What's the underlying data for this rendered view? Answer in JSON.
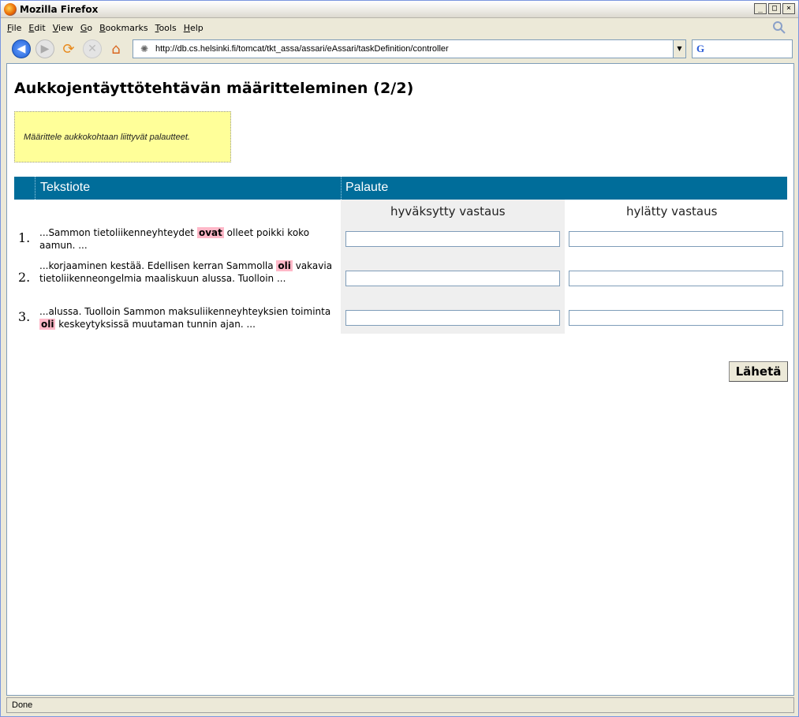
{
  "window": {
    "title": "Mozilla Firefox",
    "controls": {
      "minimize": "_",
      "maximize": "□",
      "close": "×"
    }
  },
  "menu": {
    "items": [
      {
        "underline": "F",
        "rest": "ile"
      },
      {
        "underline": "E",
        "rest": "dit"
      },
      {
        "underline": "V",
        "rest": "iew"
      },
      {
        "underline": "G",
        "rest": "o"
      },
      {
        "underline": "B",
        "rest": "ookmarks"
      },
      {
        "underline": "T",
        "rest": "ools"
      },
      {
        "underline": "H",
        "rest": "elp"
      }
    ]
  },
  "navigation": {
    "url": "http://db.cs.helsinki.fi/tomcat/tkt_assa/assari/eAssari/taskDefinition/controller",
    "search_engine_glyph": "G",
    "search_value": ""
  },
  "page": {
    "title": "Aukkojentäyttötehtävän määritteleminen (2/2)",
    "instruction": "Määrittele aukkokohtaan liittyvät palautteet.",
    "table": {
      "col_text": "Tekstiote",
      "col_feedback": "Palaute",
      "sub_accepted": "hyväksytty vastaus",
      "sub_rejected": "hylätty vastaus",
      "rows": [
        {
          "num": "1.",
          "before": "...Sammon tietoliikenneyhteydet ",
          "gap": "ovat",
          "after": " olleet poikki koko aamun. ...",
          "accepted": "",
          "rejected": ""
        },
        {
          "num": "2.",
          "before": "...korjaaminen kestää. Edellisen kerran Sammolla ",
          "gap": "oli",
          "after": " vakavia tietoliikenneongelmia maaliskuun alussa. Tuolloin ...",
          "accepted": "",
          "rejected": ""
        },
        {
          "num": "3.",
          "before": "...alussa. Tuolloin Sammon maksuliikenneyhteyksien toiminta ",
          "gap": "oli",
          "after": " keskeytyksissä muutaman tunnin ajan. ...",
          "accepted": "",
          "rejected": ""
        }
      ]
    },
    "submit_label": "Lähetä"
  },
  "status": {
    "text": "Done"
  },
  "colors": {
    "header_bg": "#006d9a",
    "highlight": "#ffb8c8",
    "note_bg": "#ffff99"
  }
}
